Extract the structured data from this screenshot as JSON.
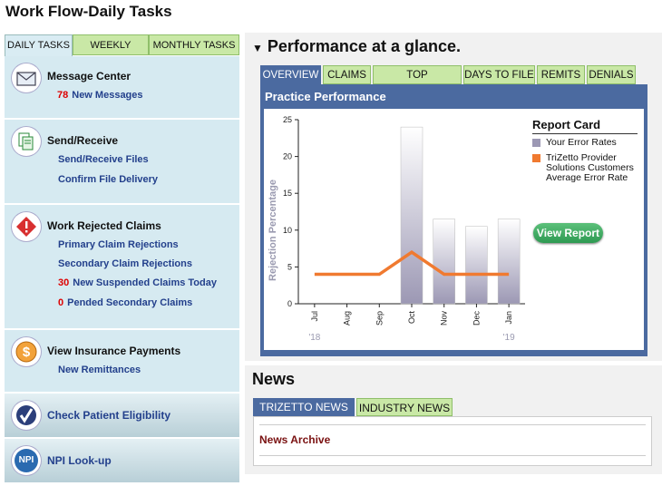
{
  "header": {
    "title": "Work Flow-Daily Tasks"
  },
  "left_tabs": [
    {
      "label": "DAILY TASKS",
      "active": true
    },
    {
      "label": "WEEKLY TASKS",
      "active": false
    },
    {
      "label": "MONTHLY TASKS",
      "active": false
    }
  ],
  "sections": {
    "message_center": {
      "title": "Message Center",
      "count": "78",
      "link": "New Messages",
      "icon": "envelope-icon"
    },
    "send_receive": {
      "title": "Send/Receive",
      "links": [
        "Send/Receive Files",
        "Confirm File Delivery"
      ],
      "icon": "documents-icon"
    },
    "rejected": {
      "title": "Work Rejected Claims",
      "icon": "warning-diamond-icon",
      "links": [
        "Primary Claim Rejections",
        "Secondary Claim Rejections"
      ],
      "suspended_count": "30",
      "suspended_label": "New Suspended Claims Today",
      "pended_count": "0",
      "pended_label": "Pended Secondary Claims"
    },
    "payments": {
      "title": "View Insurance Payments",
      "link": "New Remittances",
      "icon": "dollar-coin-icon"
    },
    "eligibility": {
      "title": "Check Patient Eligibility",
      "icon": "checkmark-icon"
    },
    "npi": {
      "title": "NPI Look-up",
      "icon": "npi-icon",
      "icon_text": "NPI"
    }
  },
  "performance": {
    "heading": "Performance at a glance.",
    "tabs": [
      {
        "label": "OVERVIEW",
        "active": true
      },
      {
        "label": "CLAIMS",
        "active": false
      },
      {
        "label": "TOP REJECTIONS",
        "active": false
      },
      {
        "label": "DAYS TO FILE",
        "active": false
      },
      {
        "label": "REMITS",
        "active": false
      },
      {
        "label": "DENIALS",
        "active": false
      }
    ],
    "chart_title": "Practice Performance",
    "report_card": {
      "title": "Report Card",
      "legend": [
        {
          "label": "Your Error Rates",
          "color": "#9c98b4"
        },
        {
          "label": "TriZetto Provider Solutions Customers Average Error Rate",
          "color": "#f07a30"
        }
      ],
      "button": "View Report"
    }
  },
  "chart_data": {
    "type": "bar",
    "ylabel": "Rejection Percentage",
    "ylim": [
      0,
      25
    ],
    "yticks": [
      0,
      5,
      10,
      15,
      20,
      25
    ],
    "categories": [
      "Jul",
      "Aug",
      "Sep",
      "Oct",
      "Nov",
      "Dec",
      "Jan"
    ],
    "year_labels": [
      {
        "label": "'18",
        "at": "Jul"
      },
      {
        "label": "'19",
        "at": "Jan"
      }
    ],
    "series": [
      {
        "name": "Your Error Rates",
        "type": "bar",
        "values": [
          0,
          0,
          0,
          24,
          11.5,
          10.5,
          11.5
        ],
        "color": "#9c98b4"
      },
      {
        "name": "TriZetto Provider Solutions Customers Average Error Rate",
        "type": "line",
        "values": [
          4,
          4,
          4,
          7,
          4,
          4,
          4
        ],
        "color": "#f07a30"
      }
    ],
    "grid": false,
    "legend": "right"
  },
  "news": {
    "heading": "News",
    "tabs": [
      {
        "label": "TRIZETTO NEWS",
        "active": true
      },
      {
        "label": "INDUSTRY NEWS",
        "active": false
      }
    ],
    "archive_link": "News Archive"
  },
  "colors": {
    "link": "#23408c",
    "count": "#dd0000",
    "tab_green": "#c9e8a6",
    "tab_blue": "#4b6aa0",
    "line_orange": "#f07a30"
  }
}
